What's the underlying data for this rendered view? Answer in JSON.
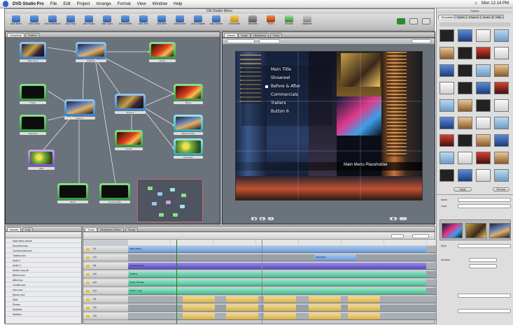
{
  "menubar": {
    "app": "DVD Studio Pro",
    "items": [
      "File",
      "Edit",
      "Project",
      "Arrange",
      "Format",
      "View",
      "Window",
      "Help"
    ],
    "clock": "Mon 12:14 PM"
  },
  "window": {
    "title": "Old Studio Menu",
    "toolbar": [
      "Add Menu",
      "Add Track",
      "Add Slideshow",
      "Add Story",
      "Add Script",
      "Add Layer",
      "Add Subtitle",
      "Add Text",
      "Add Item",
      "Add Button",
      "Add Chapter",
      "Add Marker",
      "Customize",
      "Simulate",
      "Burn",
      "Encode",
      "Inspector"
    ]
  },
  "graph": {
    "tabs": [
      "Graphical",
      "Outline"
    ],
    "nodes": [
      "Main Menu",
      "Chapters",
      "Extras",
      "Trailer",
      "Scene 1",
      "Scene 2",
      "Bonus",
      "Showreel",
      "Before & After",
      "Credits",
      "Featurette",
      "Stills",
      "Music",
      "Commercials",
      "Intro",
      "Photos",
      "Loop"
    ]
  },
  "viewer": {
    "tabs": [
      "Viewer",
      "Track",
      "Slideshow",
      "Story"
    ],
    "menu_items": [
      "Main Title",
      "Showreel",
      "Before & After",
      "Commercials",
      "Trailers",
      "Button 6"
    ],
    "caption": "Main Menu Placeholder"
  },
  "tracklist": {
    "tabs": [
      "Assets",
      "Log"
    ],
    "rows": [
      "Main Menu Movie",
      "Showreel.mov",
      "Commercials.mov",
      "Trailers.mov",
      "Audio 1",
      "Audio 2",
      "Music Loop.aif",
      "Before.mov",
      "After.mov",
      "Credits.mov",
      "Intro.mov",
      "Bonus.mov",
      "Stills",
      "Photos",
      "Subtitles",
      "Markers"
    ]
  },
  "timeline": {
    "tabs": [
      "Track",
      "Slideshow Editor",
      "Script"
    ],
    "tracks": [
      "V1",
      "V2",
      "A1",
      "A2",
      "A3",
      "A4",
      "S1",
      "S2",
      "S3"
    ],
    "clips": [
      "Main Menu",
      "Showreel",
      "Commercials",
      "Trailers",
      "Audio Stream",
      "Music Loop"
    ]
  },
  "palette": {
    "title": "Palette",
    "tabs": [
      "Templates",
      "Styles",
      "Shapes",
      "Audio",
      "Stills"
    ],
    "buttons": [
      "Apply",
      "Remove"
    ],
    "fields": [
      "Name",
      "Layer",
      "Style",
      "Duration"
    ]
  }
}
